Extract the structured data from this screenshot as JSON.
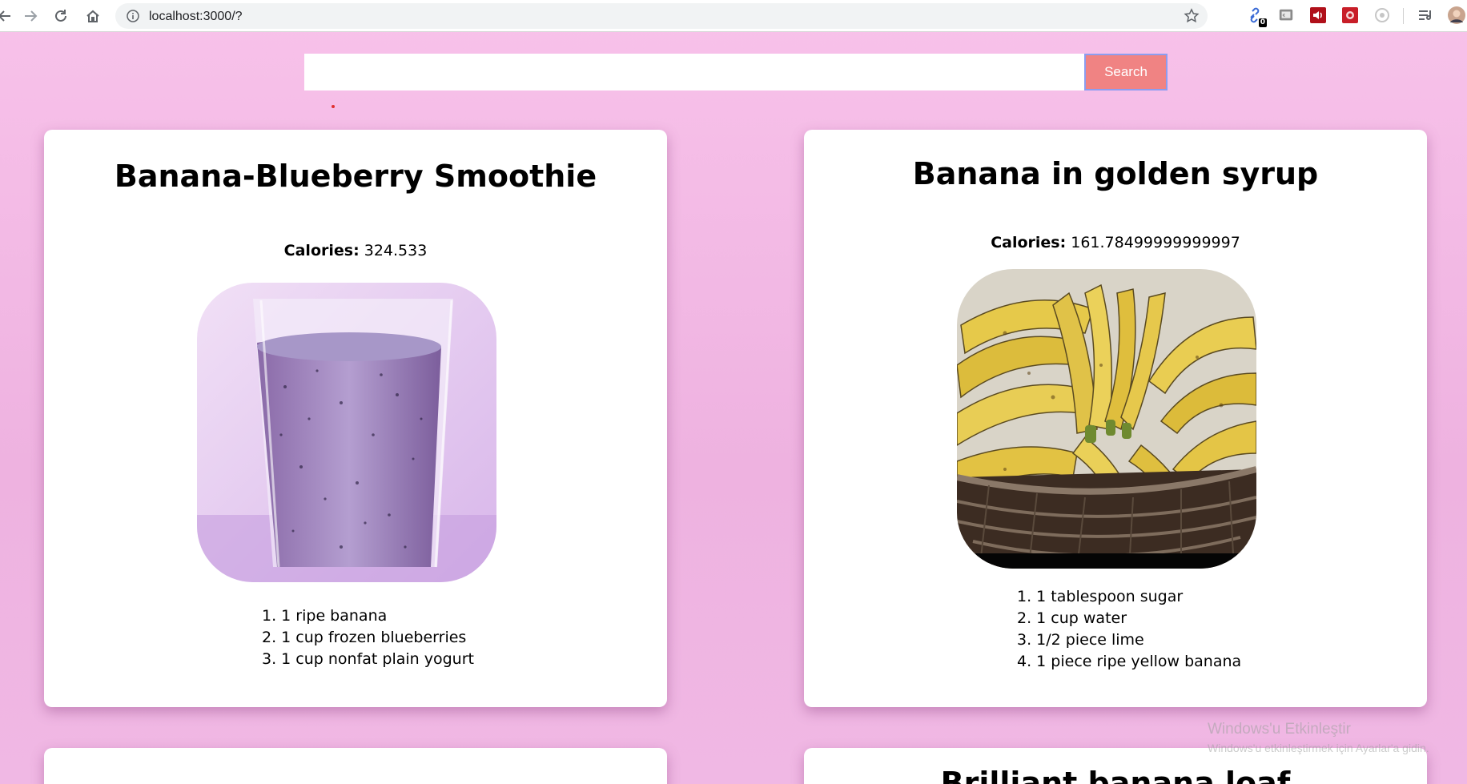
{
  "browser": {
    "url": "localhost:3000/?",
    "extension_badge": "0"
  },
  "search": {
    "value": "",
    "button_label": "Search"
  },
  "recipes": [
    {
      "title": "Banana-Blueberry Smoothie",
      "calories_label": "Calories:",
      "calories_value": "324.533",
      "image": "blueberry-smoothie-glass",
      "ingredients": [
        "1. 1 ripe banana",
        "2. 1 cup frozen blueberries",
        "3. 1 cup nonfat plain yogurt"
      ]
    },
    {
      "title": "Banana in golden syrup",
      "calories_label": "Calories:",
      "calories_value": "161.78499999999997",
      "image": "bananas-in-basket",
      "ingredients": [
        "1. 1 tablespoon sugar",
        "2. 1 cup water",
        "3. 1/2 piece lime",
        "4. 1 piece ripe yellow banana"
      ]
    },
    {
      "title": "",
      "calories_label": "",
      "calories_value": "",
      "image": "",
      "ingredients": []
    },
    {
      "title": "Brilliant banana loaf",
      "calories_label": "",
      "calories_value": "",
      "image": "",
      "ingredients": []
    }
  ],
  "watermark": {
    "line1": "Windows'u Etkinleştir",
    "line2": "Windows'u etkinleştirmek için Ayarlar'a gidin."
  },
  "colors": {
    "background": "#f6bfe8",
    "search_button": "#f08383",
    "search_button_border": "#8c9df0"
  }
}
